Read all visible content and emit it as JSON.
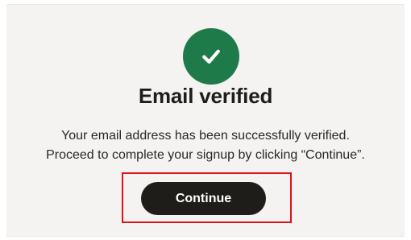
{
  "verification": {
    "icon": "check-icon",
    "title": "Email verified",
    "message_line1": "Your email address has been successfully verified.",
    "message_line2": "Proceed to complete your signup by clicking “Continue”."
  },
  "actions": {
    "continue_label": "Continue"
  },
  "colors": {
    "success": "#1f7a4a",
    "button": "#1f1d1a",
    "highlight": "#e0131a",
    "card_background": "#f4f3f1"
  }
}
